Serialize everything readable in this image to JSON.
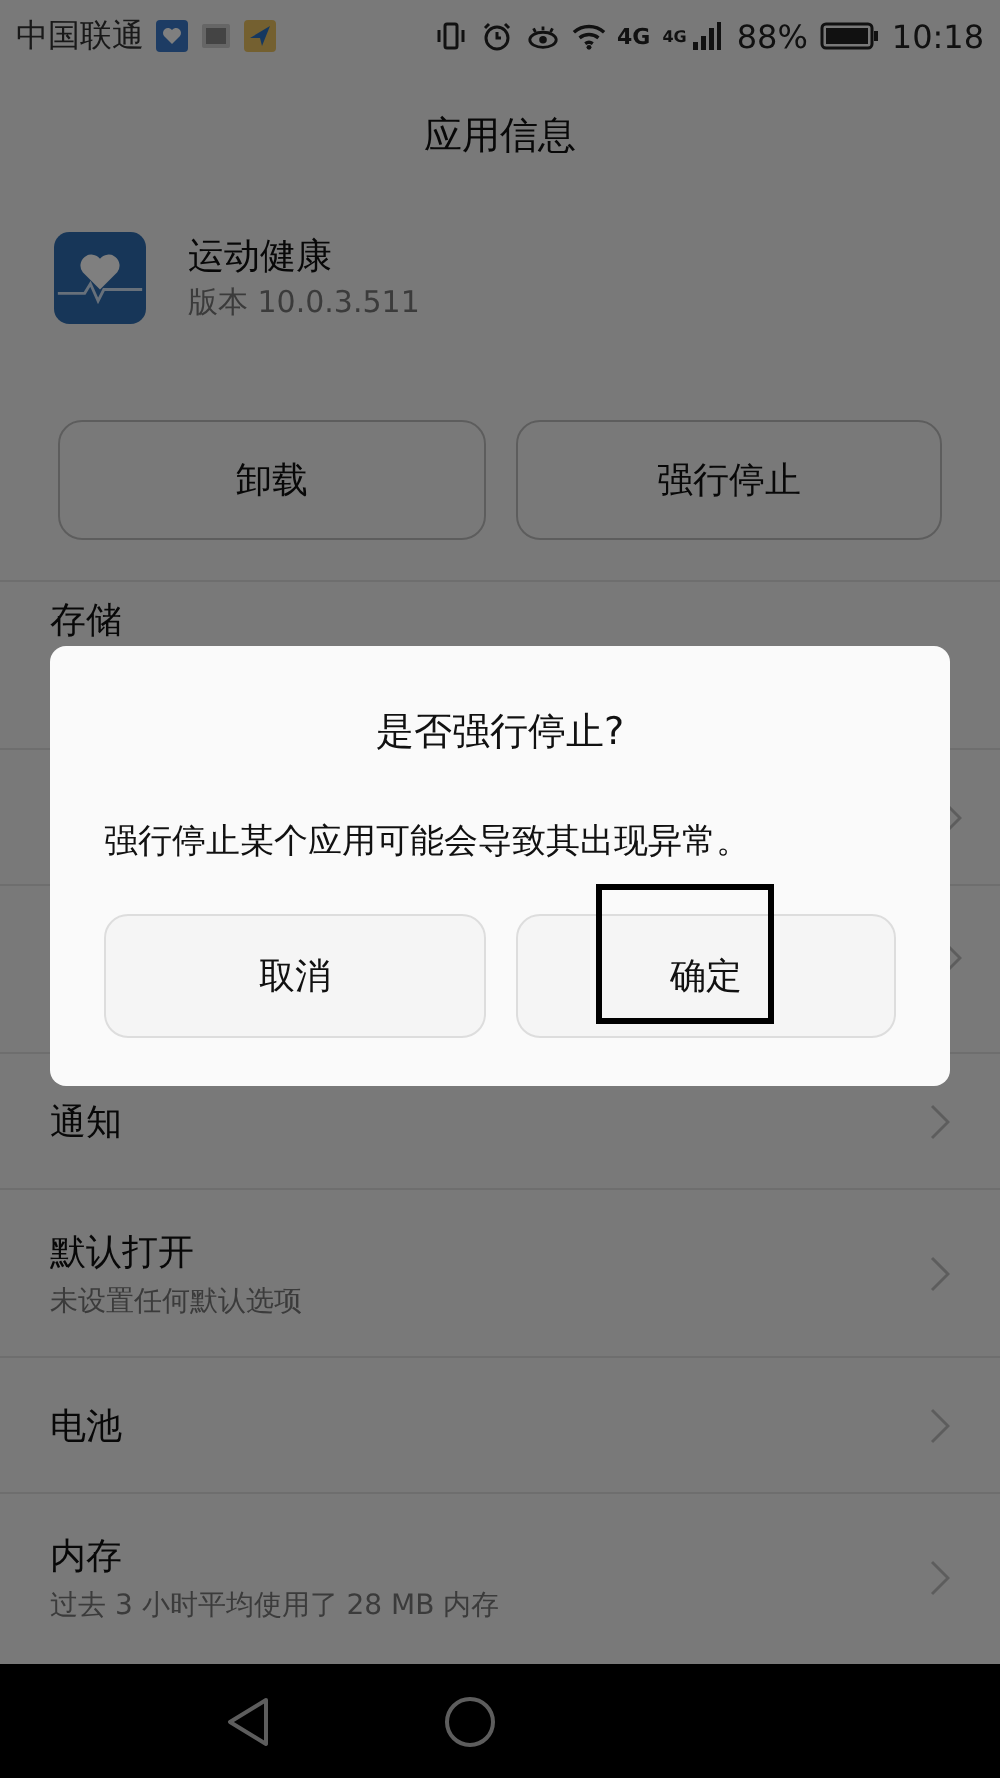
{
  "status_bar": {
    "carrier": "中国联通",
    "network_labels": [
      "4G",
      "4G"
    ],
    "battery": "88%",
    "time": "10:18"
  },
  "title": "应用信息",
  "app": {
    "name": "运动健康",
    "version": "版本 10.0.3.511"
  },
  "actions": [
    "卸载",
    "强行停止"
  ],
  "rows": [
    {
      "kind": "double",
      "title": "存储"
    },
    {
      "kind": "single"
    },
    {
      "kind": "double"
    },
    {
      "kind": "single",
      "title": "通知"
    },
    {
      "kind": "double",
      "title": "默认打开",
      "subtitle": "未设置任何默认选项"
    },
    {
      "kind": "single",
      "title": "电池"
    },
    {
      "kind": "double",
      "title": "内存",
      "subtitle": "过去 3 小时平均使用了 28 MB 内存"
    }
  ],
  "dialog": {
    "title": "是否强行停止?",
    "message": "强行停止某个应用可能会导致其出现异常。",
    "buttons": [
      {
        "label": "取消",
        "highlighted": false
      },
      {
        "label": "确定",
        "highlighted": true
      }
    ]
  }
}
